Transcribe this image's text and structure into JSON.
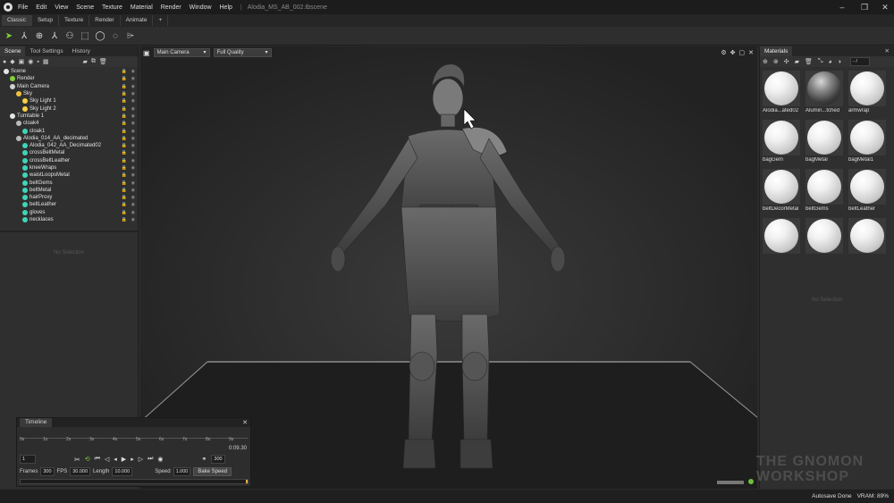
{
  "app": {
    "menu": [
      "File",
      "Edit",
      "View",
      "Scene",
      "Texture",
      "Material",
      "Render",
      "Window",
      "Help"
    ],
    "file_title": "Alodia_MS_AB_002.tbscene"
  },
  "workspace_tabs": [
    "Classic",
    "Setup",
    "Texture",
    "Render",
    "Animate",
    "+"
  ],
  "left_panel": {
    "tabs": [
      "Scene",
      "Tool Settings",
      "History"
    ],
    "tree": [
      {
        "label": "Scene",
        "indent": 0,
        "icon": "scene"
      },
      {
        "label": "Render",
        "indent": 1,
        "icon": "render"
      },
      {
        "label": "Main Camera",
        "indent": 1,
        "icon": "camera"
      },
      {
        "label": "Sky",
        "indent": 2,
        "icon": "sky"
      },
      {
        "label": "Sky Light 1",
        "indent": 3,
        "icon": "light"
      },
      {
        "label": "Sky Light 2",
        "indent": 3,
        "icon": "light"
      },
      {
        "label": "Turntable 1",
        "indent": 1,
        "icon": "turntable"
      },
      {
        "label": "cloak4",
        "indent": 2,
        "icon": "object"
      },
      {
        "label": "cloak1",
        "indent": 3,
        "icon": "mesh"
      },
      {
        "label": "Alodia_014_AA_decimated",
        "indent": 2,
        "icon": "object"
      },
      {
        "label": "Alodia_042_AA_Decimated02",
        "indent": 3,
        "icon": "mesh"
      },
      {
        "label": "crossBeltMetal",
        "indent": 3,
        "icon": "mesh"
      },
      {
        "label": "crossBeltLeather",
        "indent": 3,
        "icon": "mesh"
      },
      {
        "label": "kneeWraps",
        "indent": 3,
        "icon": "mesh"
      },
      {
        "label": "waistLoopsMetal",
        "indent": 3,
        "icon": "mesh"
      },
      {
        "label": "beltGems",
        "indent": 3,
        "icon": "mesh"
      },
      {
        "label": "beltMetal",
        "indent": 3,
        "icon": "mesh"
      },
      {
        "label": "hairProxy",
        "indent": 3,
        "icon": "mesh"
      },
      {
        "label": "beltLeather",
        "indent": 3,
        "icon": "mesh"
      },
      {
        "label": "gloves",
        "indent": 3,
        "icon": "mesh"
      },
      {
        "label": "necklaces",
        "indent": 3,
        "icon": "mesh"
      }
    ],
    "no_selection": "No Selection"
  },
  "viewport": {
    "camera": "Main Camera",
    "quality": "Full Quality"
  },
  "right_panel": {
    "tab": "Materials",
    "search": "- /",
    "materials": [
      {
        "label": "Alodia...ated02",
        "kind": "matte"
      },
      {
        "label": "Alumin...tched",
        "kind": "metal"
      },
      {
        "label": "armwrap",
        "kind": "matte"
      },
      {
        "label": "bagGem",
        "kind": "matte"
      },
      {
        "label": "bagMetal",
        "kind": "matte"
      },
      {
        "label": "bagMetal1",
        "kind": "matte"
      },
      {
        "label": "beltDecorMetal",
        "kind": "matte"
      },
      {
        "label": "beltGems",
        "kind": "matte"
      },
      {
        "label": "beltLeather",
        "kind": "matte"
      },
      {
        "label": "",
        "kind": "matte"
      },
      {
        "label": "",
        "kind": "matte"
      },
      {
        "label": "",
        "kind": "matte"
      }
    ],
    "no_selection": "No Selection"
  },
  "timeline": {
    "title": "Timeline",
    "ticks": [
      "0s",
      "1s",
      "2s",
      "3s",
      "4s",
      "5s",
      "6s",
      "7s",
      "8s",
      "9s"
    ],
    "current_time": "0:09.30",
    "frame_field": "1",
    "end_frame": "300",
    "frames_label": "Frames",
    "frames_value": "300",
    "fps_label": "FPS",
    "fps_value": "30.000",
    "length_label": "Length",
    "length_value": "10.000",
    "speed_label": "Speed",
    "speed_value": "1.000",
    "bake_label": "Bake Speed"
  },
  "status": {
    "autosave": "Autosave Done",
    "vram": "VRAM: 89%"
  },
  "watermark": {
    "line1": "THE GNOMON",
    "line2": "WORKSHOP"
  },
  "colors": {
    "accent_green": "#7fd13b",
    "mesh_icon": "#3fd4b8"
  }
}
